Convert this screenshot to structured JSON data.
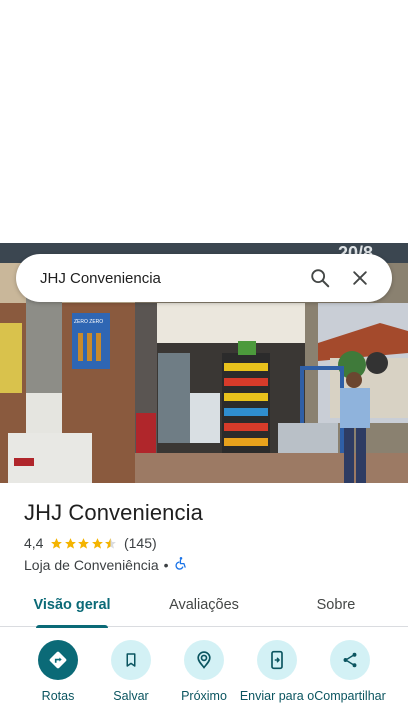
{
  "search": {
    "query": "JHJ Conveniencia"
  },
  "place": {
    "name": "JHJ Conveniencia",
    "rating": "4,4",
    "rating_value": 4.4,
    "review_count": "(145)",
    "category": "Loja de Conveniência",
    "separator": "•",
    "accessibility_icon": "wheelchair-icon"
  },
  "photo_sign": {
    "bottle_ad_text": "ZERO ZERO",
    "top_sign_text": "20/8"
  },
  "tabs": [
    {
      "label": "Visão geral",
      "active": true
    },
    {
      "label": "Avaliações",
      "active": false
    },
    {
      "label": "Sobre",
      "active": false
    }
  ],
  "actions": [
    {
      "label": "Rotas",
      "icon": "directions-icon"
    },
    {
      "label": "Salvar",
      "icon": "bookmark-icon"
    },
    {
      "label": "Próximo",
      "icon": "nearby-icon"
    },
    {
      "label": "Enviar para o",
      "icon": "send-to-phone-icon"
    },
    {
      "label": "Compartilhar",
      "icon": "share-icon"
    }
  ],
  "colors": {
    "accent": "#0b6a77",
    "action_bg": "#d3f1f5",
    "star": "#f4b400"
  }
}
